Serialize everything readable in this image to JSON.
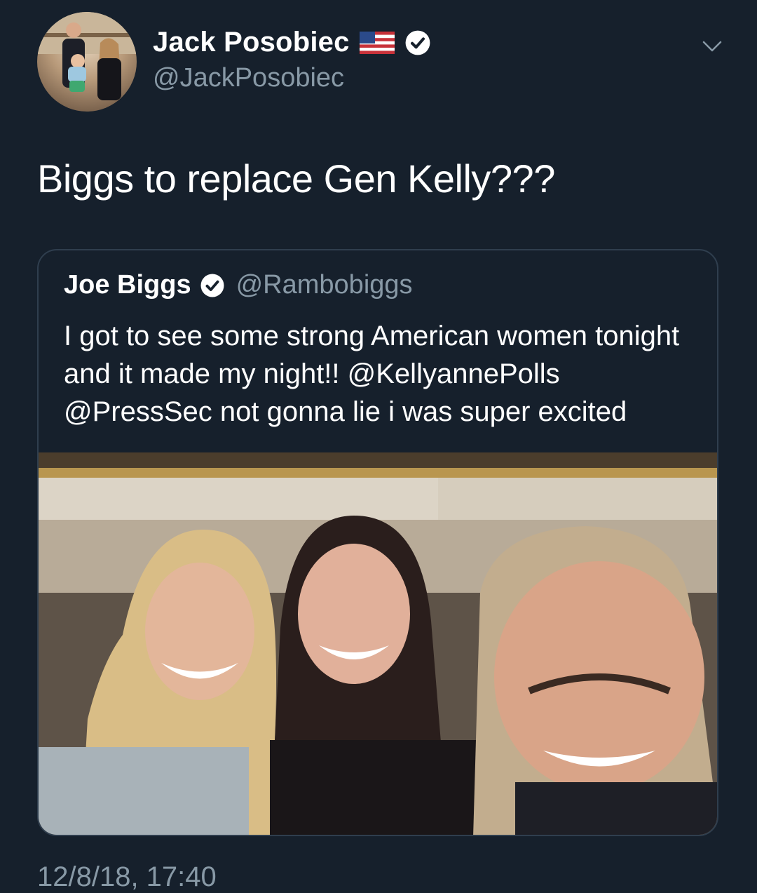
{
  "tweet": {
    "author": {
      "display_name": "Jack Posobiec",
      "handle": "@JackPosobiec",
      "verified": true,
      "flag_icon": "us-flag-icon"
    },
    "text": "Biggs to replace Gen Kelly???",
    "timestamp": "12/8/18, 17:40",
    "quoted": {
      "display_name": "Joe Biggs",
      "handle": "@Rambobiggs",
      "verified": true,
      "text": "I got to see some strong American women tonight and it made my night!! @KellyannePolls @PressSec not gonna lie i was super excited"
    }
  },
  "colors": {
    "background": "#16202c",
    "secondary_text": "#8899a6",
    "border": "#2f3e4e"
  }
}
